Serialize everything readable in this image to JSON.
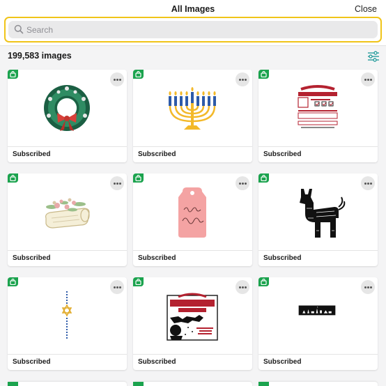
{
  "header": {
    "title": "All Images",
    "close_label": "Close"
  },
  "search": {
    "placeholder": "Search"
  },
  "results": {
    "count_label": "199,583 images"
  },
  "colors": {
    "accent": "#f0c419",
    "badge": "#1ba34e"
  },
  "cards": [
    {
      "image": "christmas-wreath",
      "label": "Subscribed"
    },
    {
      "image": "menorah",
      "label": "Subscribed"
    },
    {
      "image": "north-pole-express-delivery-label",
      "label": "Subscribed"
    },
    {
      "image": "floral-log-centerpiece",
      "label": "Subscribed"
    },
    {
      "image": "happy-holidays-gift-tag",
      "label": "Subscribed"
    },
    {
      "image": "pinata",
      "label": "Subscribed"
    },
    {
      "image": "happy-hanukkah-star",
      "label": "Subscribed"
    },
    {
      "image": "north-pole-toy-co-sign",
      "label": "Subscribed"
    },
    {
      "image": "nativity-banner",
      "label": "Subscribed"
    }
  ]
}
